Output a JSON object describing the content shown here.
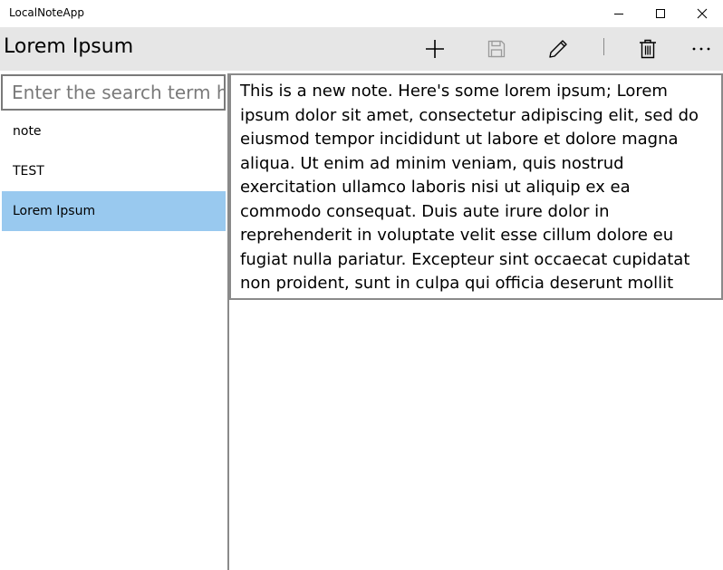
{
  "window": {
    "title": "LocalNoteApp"
  },
  "commandbar": {
    "page_title": "Lorem Ipsum",
    "buttons": [
      {
        "name": "add",
        "icon": "plus-icon"
      },
      {
        "name": "save",
        "icon": "save-icon",
        "enabled": false
      },
      {
        "name": "edit",
        "icon": "pencil-icon"
      },
      {
        "name": "delete",
        "icon": "trash-icon"
      },
      {
        "name": "more",
        "icon": "more-icon"
      }
    ]
  },
  "search": {
    "placeholder": "Enter the search term here",
    "value": ""
  },
  "notes": [
    {
      "title": "note",
      "selected": false
    },
    {
      "title": "TEST",
      "selected": false
    },
    {
      "title": "Lorem Ipsum",
      "selected": true
    }
  ],
  "editor": {
    "content": "This is a new note. Here's some lorem ipsum; Lorem ipsum dolor sit amet, consectetur adipiscing elit, sed do eiusmod tempor incididunt ut labore et dolore magna aliqua. Ut enim ad minim veniam, quis nostrud exercitation ullamco laboris nisi ut aliquip ex ea commodo consequat. Duis aute irure dolor in reprehenderit in voluptate velit esse cillum dolore eu fugiat nulla pariatur. Excepteur sint occaecat cupidatat non proident, sunt in culpa qui officia deserunt mollit anim id est laborum."
  },
  "colors": {
    "selection": "#99c9ef",
    "commandbar_bg": "#e6e6e6",
    "border": "#8a8a8a"
  }
}
